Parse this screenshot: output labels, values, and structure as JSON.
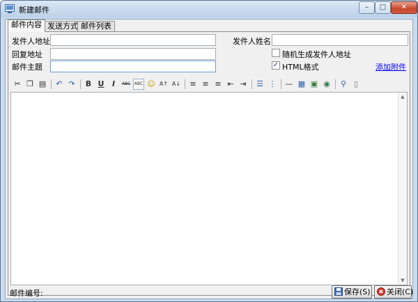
{
  "window": {
    "title": "新建邮件",
    "min_glyph": "–",
    "max_glyph": "□",
    "close_glyph": "✕"
  },
  "tabs": [
    {
      "label": "邮件内容",
      "active": true
    },
    {
      "label": "发送方式",
      "active": false
    },
    {
      "label": "邮件列表",
      "active": false
    }
  ],
  "form": {
    "sender_address_label": "发件人地址",
    "sender_address_value": "",
    "sender_name_label": "发件人姓名",
    "sender_name_value": "",
    "reply_address_label": "回复地址",
    "reply_address_value": "",
    "subject_label": "邮件主题",
    "subject_value": "",
    "random_sender_label": "随机生成发件人地址",
    "random_sender_checked": false,
    "html_format_label": "HTML格式",
    "html_format_checked": true,
    "add_attachment_label": "添加附件"
  },
  "toolbar": {
    "cut_glyph": "✂",
    "copy_glyph": "❐",
    "paste_glyph": "▤",
    "undo_glyph": "↶",
    "redo_glyph": "↷",
    "bold_glyph": "B",
    "underline_glyph": "U",
    "italic_glyph": "I",
    "strike_glyph": "ABC",
    "spell_glyph": "ABC",
    "emoji_glyph": "☺",
    "sort_asc_glyph": "A↑",
    "sort_desc_glyph": "A↓",
    "align_left_glyph": "≡",
    "align_center_glyph": "≡",
    "align_right_glyph": "≡",
    "outdent_glyph": "⇤",
    "indent_glyph": "⇥",
    "bullet_list_glyph": "☰",
    "number_list_glyph": "⋮",
    "hr_glyph": "—",
    "table_glyph": "▦",
    "image_glyph": "▣",
    "web_glyph": "◉",
    "find_glyph": "⚲",
    "doc_glyph": "▯"
  },
  "status": {
    "mail_number_label": "邮件编号:",
    "mail_number_value": ""
  },
  "buttons": {
    "save_label": "保存(S)",
    "close_label": "关闭(C)"
  },
  "colors": {
    "title_gradient_top": "#dbe7f4",
    "close_button": "#c7452b",
    "link": "#0000ee"
  }
}
